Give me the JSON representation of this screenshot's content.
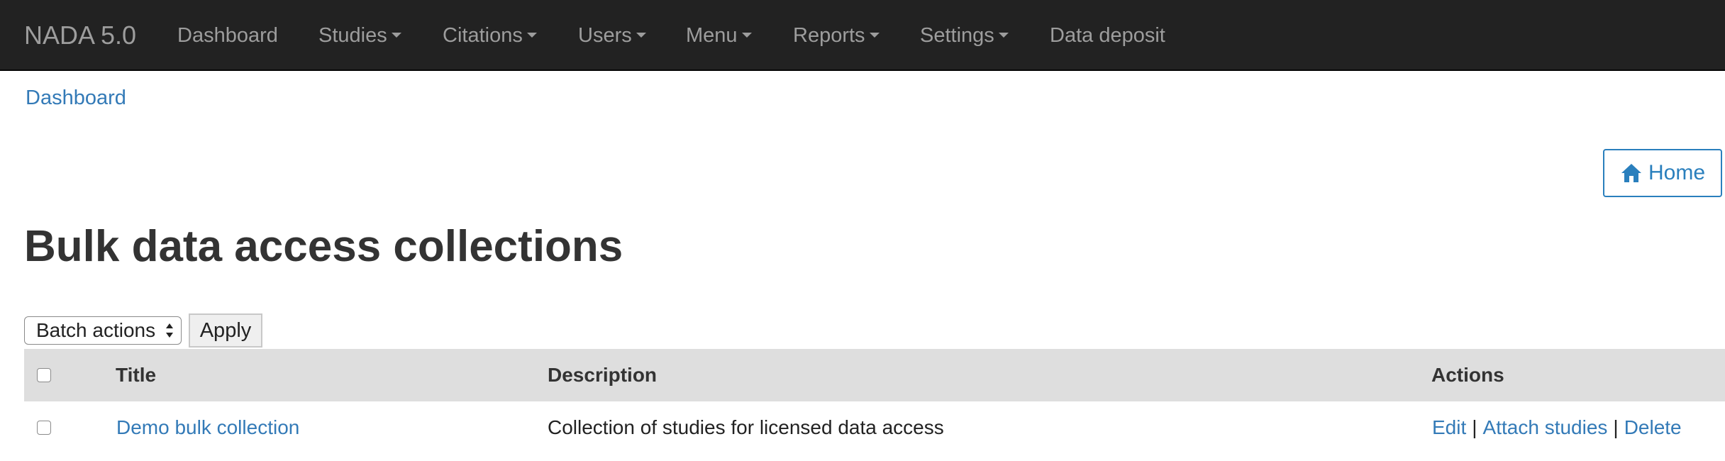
{
  "navbar": {
    "brand": "NADA 5.0",
    "items": [
      {
        "label": "Dashboard",
        "dropdown": false
      },
      {
        "label": "Studies",
        "dropdown": true
      },
      {
        "label": "Citations",
        "dropdown": true
      },
      {
        "label": "Users",
        "dropdown": true
      },
      {
        "label": "Menu",
        "dropdown": true
      },
      {
        "label": "Reports",
        "dropdown": true
      },
      {
        "label": "Settings",
        "dropdown": true
      },
      {
        "label": "Data deposit",
        "dropdown": false
      }
    ]
  },
  "breadcrumb": {
    "label": "Dashboard"
  },
  "home_button": {
    "label": "Home",
    "icon": "home-icon"
  },
  "page": {
    "title": "Bulk data access collections"
  },
  "toolbar": {
    "batch_select_value": "Batch actions",
    "apply_label": "Apply"
  },
  "table": {
    "headers": {
      "title": "Title",
      "description": "Description",
      "actions": "Actions"
    },
    "rows": [
      {
        "title": "Demo bulk collection",
        "description": "Collection of studies for licensed data access",
        "actions": [
          "Edit",
          "Attach studies",
          "Delete"
        ],
        "separator": "|"
      }
    ]
  },
  "colors": {
    "navbar_bg": "#222222",
    "link": "#337ab7",
    "header_row_bg": "#dedede",
    "home_button": "#2a7fbd"
  }
}
